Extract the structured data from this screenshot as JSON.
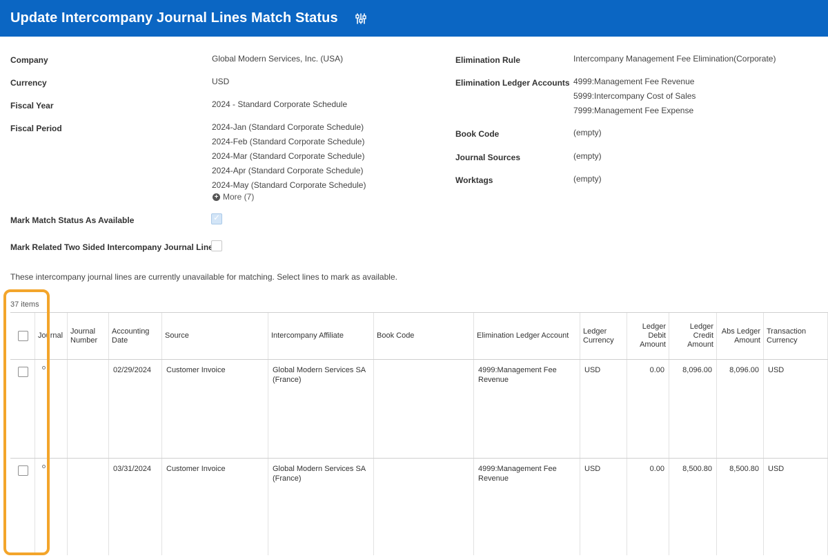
{
  "header": {
    "title": "Update Intercompany Journal Lines Match Status",
    "settings_icon": "related-actions-icon"
  },
  "left_fields": [
    {
      "label": "Company",
      "values": [
        "Global Modern Services, Inc. (USA)"
      ]
    },
    {
      "label": "Currency",
      "values": [
        "USD"
      ]
    },
    {
      "label": "Fiscal Year",
      "values": [
        "2024 - Standard Corporate Schedule"
      ]
    },
    {
      "label": "Fiscal Period",
      "values": [
        "2024-Jan (Standard Corporate Schedule)",
        "2024-Feb (Standard Corporate Schedule)",
        "2024-Mar (Standard Corporate Schedule)",
        "2024-Apr (Standard Corporate Schedule)",
        "2024-May (Standard Corporate Schedule)"
      ],
      "more_label": "More (7)"
    }
  ],
  "right_fields": [
    {
      "label": "Elimination Rule",
      "values": [
        "Intercompany Management Fee Elimination(Corporate)"
      ]
    },
    {
      "label": "Elimination Ledger Accounts",
      "values": [
        "4999:Management Fee Revenue",
        "5999:Intercompany Cost of Sales",
        "7999:Management Fee Expense"
      ]
    },
    {
      "label": "Book Code",
      "values": [
        "(empty)"
      ]
    },
    {
      "label": "Journal Sources",
      "values": [
        "(empty)"
      ]
    },
    {
      "label": "Worktags",
      "values": [
        "(empty)"
      ]
    }
  ],
  "options": {
    "mark_available_label": "Mark Match Status As Available",
    "mark_available_checked": true,
    "mark_related_label": "Mark Related Two Sided Intercompany Journal Line",
    "mark_related_checked": false
  },
  "note": "These intercompany journal lines are currently unavailable for matching. Select lines to mark as available.",
  "table": {
    "count": "37 items",
    "columns": [
      "Journal",
      "Journal Number",
      "Accounting Date",
      "Source",
      "Intercompany Affiliate",
      "Book Code",
      "Elimination Ledger Account",
      "Ledger Currency",
      "Ledger Debit Amount",
      "Ledger Credit Amount",
      "Abs Ledger Amount",
      "Transaction Currency"
    ],
    "rows": [
      {
        "journal": "",
        "journal_number": "",
        "accounting_date": "02/29/2024",
        "source": "Customer Invoice",
        "affiliate": "Global Modern Services SA (France)",
        "book_code": "",
        "elim_account": "4999:Management Fee Revenue",
        "ledger_currency": "USD",
        "debit": "0.00",
        "credit": "8,096.00",
        "abs": "8,096.00",
        "txn_currency": "USD"
      },
      {
        "journal": "",
        "journal_number": "",
        "accounting_date": "03/31/2024",
        "source": "Customer Invoice",
        "affiliate": "Global Modern Services SA (France)",
        "book_code": "",
        "elim_account": "4999:Management Fee Revenue",
        "ledger_currency": "USD",
        "debit": "0.00",
        "credit": "8,500.80",
        "abs": "8,500.80",
        "txn_currency": "USD"
      }
    ]
  },
  "colors": {
    "header_bg": "#0b66c3",
    "highlight": "#f3a52b"
  }
}
